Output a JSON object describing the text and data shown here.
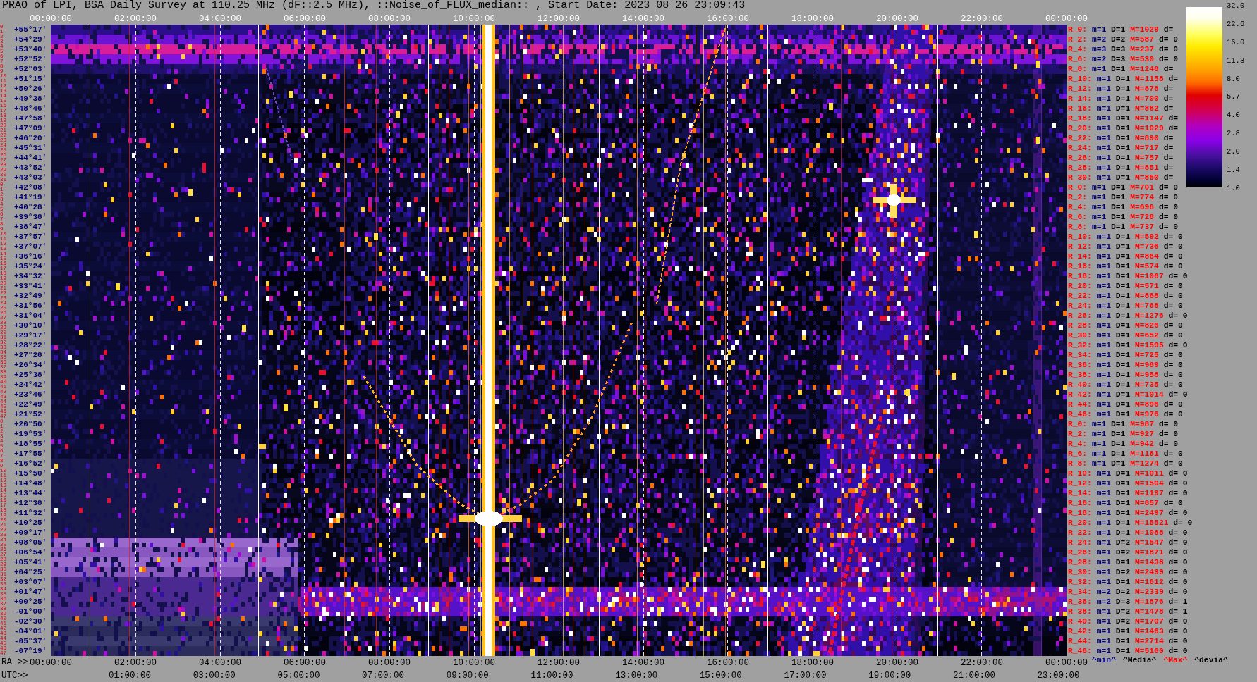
{
  "title": "PRAO of LPI, BSA Daily Survey at 110.25 MHz (dF::2.5 MHz), ::Noise_of_FLUX_median:: , Start Date: 2023 08 26 23:09:43",
  "top_axis": {
    "ticks": [
      "00:00:00",
      "02:00:00",
      "04:00:00",
      "06:00:00",
      "08:00:00",
      "10:00:00",
      "12:00:00",
      "14:00:00",
      "16:00:00",
      "18:00:00",
      "20:00:00",
      "22:00:00",
      "00:00:00"
    ]
  },
  "declination_axis": {
    "labels": [
      {
        "indices": [
          "0",
          "1"
        ],
        "declination": "+55°17′"
      },
      {
        "indices": [
          "2",
          "3"
        ],
        "declination": "+54°29′"
      },
      {
        "indices": [
          "4",
          "5"
        ],
        "declination": "+53°40′"
      },
      {
        "indices": [
          "6",
          "7"
        ],
        "declination": "+52°52′"
      },
      {
        "indices": [
          "8",
          "9"
        ],
        "declination": "+52°03′"
      },
      {
        "indices": [
          "10",
          "11"
        ],
        "declination": "+51°15′"
      },
      {
        "indices": [
          "12",
          "13"
        ],
        "declination": "+50°26′"
      },
      {
        "indices": [
          "14",
          "15"
        ],
        "declination": "+49°38′"
      },
      {
        "indices": [
          "16",
          "17"
        ],
        "declination": "+48°46′"
      },
      {
        "indices": [
          "18",
          "19"
        ],
        "declination": "+47°58′"
      },
      {
        "indices": [
          "20",
          "21"
        ],
        "declination": "+47°09′"
      },
      {
        "indices": [
          "22",
          "23"
        ],
        "declination": "+46°20′"
      },
      {
        "indices": [
          "24",
          "25"
        ],
        "declination": "+45°31′"
      },
      {
        "indices": [
          "26",
          "27"
        ],
        "declination": "+44°41′"
      },
      {
        "indices": [
          "28",
          "29"
        ],
        "declination": "+43°52′"
      },
      {
        "indices": [
          "30",
          "31"
        ],
        "declination": "+43°03′"
      },
      {
        "indices": [
          "0",
          "1"
        ],
        "declination": "+42°08′"
      },
      {
        "indices": [
          "2",
          "3"
        ],
        "declination": "+41°19′"
      },
      {
        "indices": [
          "4",
          "5"
        ],
        "declination": "+40°28′"
      },
      {
        "indices": [
          "6",
          "7"
        ],
        "declination": "+39°38′"
      },
      {
        "indices": [
          "8",
          "9"
        ],
        "declination": "+38°47′"
      },
      {
        "indices": [
          "10",
          "11"
        ],
        "declination": "+37°57′"
      },
      {
        "indices": [
          "12",
          "13"
        ],
        "declination": "+37°07′"
      },
      {
        "indices": [
          "14",
          "15"
        ],
        "declination": "+36°16′"
      },
      {
        "indices": [
          "16",
          "17"
        ],
        "declination": "+35°24′"
      },
      {
        "indices": [
          "18",
          "19"
        ],
        "declination": "+34°32′"
      },
      {
        "indices": [
          "20",
          "21"
        ],
        "declination": "+33°41′"
      },
      {
        "indices": [
          "22",
          "23"
        ],
        "declination": "+32°49′"
      },
      {
        "indices": [
          "24",
          "25"
        ],
        "declination": "+31°56′"
      },
      {
        "indices": [
          "26",
          "27"
        ],
        "declination": "+31°04′"
      },
      {
        "indices": [
          "28",
          "29"
        ],
        "declination": "+30°10′"
      },
      {
        "indices": [
          "30",
          "31"
        ],
        "declination": "+29°17′"
      },
      {
        "indices": [
          "32",
          "33"
        ],
        "declination": "+28°22′"
      },
      {
        "indices": [
          "34",
          "35"
        ],
        "declination": "+27°28′"
      },
      {
        "indices": [
          "36",
          "37"
        ],
        "declination": "+26°34′"
      },
      {
        "indices": [
          "38",
          "39"
        ],
        "declination": "+25°38′"
      },
      {
        "indices": [
          "40",
          "41"
        ],
        "declination": "+24°42′"
      },
      {
        "indices": [
          "42",
          "43"
        ],
        "declination": "+23°46′"
      },
      {
        "indices": [
          "44",
          "45"
        ],
        "declination": "+22°49′"
      },
      {
        "indices": [
          "46",
          "47"
        ],
        "declination": "+21°52′"
      },
      {
        "indices": [
          "0",
          "1"
        ],
        "declination": "+20°50′"
      },
      {
        "indices": [
          "2",
          "3"
        ],
        "declination": "+19°53′"
      },
      {
        "indices": [
          "4",
          "5"
        ],
        "declination": "+18°55′"
      },
      {
        "indices": [
          "6",
          "7"
        ],
        "declination": "+17°55′"
      },
      {
        "indices": [
          "8",
          "9"
        ],
        "declination": "+16°52′"
      },
      {
        "indices": [
          "10",
          "11"
        ],
        "declination": "+15°50′"
      },
      {
        "indices": [
          "12",
          "13"
        ],
        "declination": "+14°48′"
      },
      {
        "indices": [
          "14",
          "15"
        ],
        "declination": "+13°44′"
      },
      {
        "indices": [
          "16",
          "17"
        ],
        "declination": "+12°38′"
      },
      {
        "indices": [
          "18",
          "19"
        ],
        "declination": "+11°32′"
      },
      {
        "indices": [
          "20",
          "21"
        ],
        "declination": "+10°25′"
      },
      {
        "indices": [
          "22",
          "23"
        ],
        "declination": "+09°17′"
      },
      {
        "indices": [
          "24",
          "25"
        ],
        "declination": "+08°05′"
      },
      {
        "indices": [
          "26",
          "27"
        ],
        "declination": "+06°54′"
      },
      {
        "indices": [
          "28",
          "29"
        ],
        "declination": "+05°41′"
      },
      {
        "indices": [
          "30",
          "31"
        ],
        "declination": "+04°25′"
      },
      {
        "indices": [
          "32",
          "33"
        ],
        "declination": "+03°07′"
      },
      {
        "indices": [
          "34",
          "35"
        ],
        "declination": "+01°47′"
      },
      {
        "indices": [
          "36",
          "37"
        ],
        "declination": "+00°25′"
      },
      {
        "indices": [
          "38",
          "39"
        ],
        "declination": "-01°00′"
      },
      {
        "indices": [
          "40",
          "41"
        ],
        "declination": "-02°30′"
      },
      {
        "indices": [
          "42",
          "43"
        ],
        "declination": "-04°01′"
      },
      {
        "indices": [
          "44",
          "45"
        ],
        "declination": "-05°37′"
      },
      {
        "indices": [
          "46",
          "47"
        ],
        "declination": "-07°19′"
      }
    ]
  },
  "statistics": {
    "rows": [
      {
        "receiver": "R_0:",
        "min": "m=1",
        "median": "D=1",
        "max": "M=1029",
        "deviation": "d="
      },
      {
        "receiver": "R_2:",
        "min": "m=2",
        "median": "D=2",
        "max": "M=587",
        "deviation": "d= 0"
      },
      {
        "receiver": "R_4:",
        "min": "m=3",
        "median": "D=3",
        "max": "M=237",
        "deviation": "d= 0"
      },
      {
        "receiver": "R_6:",
        "min": "m=2",
        "median": "D=3",
        "max": "M=530",
        "deviation": "d= 0"
      },
      {
        "receiver": "R_8:",
        "min": "m=1",
        "median": "D=1",
        "max": "M=1248",
        "deviation": "d="
      },
      {
        "receiver": "R_10:",
        "min": "m=1",
        "median": "D=1",
        "max": "M=1158",
        "deviation": "d="
      },
      {
        "receiver": "R_12:",
        "min": "m=1",
        "median": "D=1",
        "max": "M=878",
        "deviation": "d="
      },
      {
        "receiver": "R_14:",
        "min": "m=1",
        "median": "D=1",
        "max": "M=700",
        "deviation": "d="
      },
      {
        "receiver": "R_16:",
        "min": "m=1",
        "median": "D=1",
        "max": "M=882",
        "deviation": "d="
      },
      {
        "receiver": "R_18:",
        "min": "m=1",
        "median": "D=1",
        "max": "M=1147",
        "deviation": "d="
      },
      {
        "receiver": "R_20:",
        "min": "m=1",
        "median": "D=1",
        "max": "M=1029",
        "deviation": "d="
      },
      {
        "receiver": "R_22:",
        "min": "m=1",
        "median": "D=1",
        "max": "M=890",
        "deviation": "d="
      },
      {
        "receiver": "R_24:",
        "min": "m=1",
        "median": "D=1",
        "max": "M=717",
        "deviation": "d="
      },
      {
        "receiver": "R_26:",
        "min": "m=1",
        "median": "D=1",
        "max": "M=757",
        "deviation": "d="
      },
      {
        "receiver": "R_28:",
        "min": "m=1",
        "median": "D=1",
        "max": "M=851",
        "deviation": "d="
      },
      {
        "receiver": "R_30:",
        "min": "m=1",
        "median": "D=1",
        "max": "M=850",
        "deviation": "d="
      },
      {
        "receiver": "R_0:",
        "min": "m=1",
        "median": "D=1",
        "max": "M=701",
        "deviation": "d= 0"
      },
      {
        "receiver": "R_2:",
        "min": "m=1",
        "median": "D=1",
        "max": "M=774",
        "deviation": "d= 0"
      },
      {
        "receiver": "R_4:",
        "min": "m=1",
        "median": "D=1",
        "max": "M=696",
        "deviation": "d= 0"
      },
      {
        "receiver": "R_6:",
        "min": "m=1",
        "median": "D=1",
        "max": "M=728",
        "deviation": "d= 0"
      },
      {
        "receiver": "R_8:",
        "min": "m=1",
        "median": "D=1",
        "max": "M=737",
        "deviation": "d= 0"
      },
      {
        "receiver": "R_10:",
        "min": "m=1",
        "median": "D=1",
        "max": "M=592",
        "deviation": "d= 0"
      },
      {
        "receiver": "R_12:",
        "min": "m=1",
        "median": "D=1",
        "max": "M=736",
        "deviation": "d= 0"
      },
      {
        "receiver": "R_14:",
        "min": "m=1",
        "median": "D=1",
        "max": "M=864",
        "deviation": "d= 0"
      },
      {
        "receiver": "R_16:",
        "min": "m=1",
        "median": "D=1",
        "max": "M=574",
        "deviation": "d= 0"
      },
      {
        "receiver": "R_18:",
        "min": "m=1",
        "median": "D=1",
        "max": "M=1067",
        "deviation": "d= 0"
      },
      {
        "receiver": "R_20:",
        "min": "m=1",
        "median": "D=1",
        "max": "M=571",
        "deviation": "d= 0"
      },
      {
        "receiver": "R_22:",
        "min": "m=1",
        "median": "D=1",
        "max": "M=868",
        "deviation": "d= 0"
      },
      {
        "receiver": "R_24:",
        "min": "m=1",
        "median": "D=1",
        "max": "M=768",
        "deviation": "d= 0"
      },
      {
        "receiver": "R_26:",
        "min": "m=1",
        "median": "D=1",
        "max": "M=1276",
        "deviation": "d= 0"
      },
      {
        "receiver": "R_28:",
        "min": "m=1",
        "median": "D=1",
        "max": "M=826",
        "deviation": "d= 0"
      },
      {
        "receiver": "R_30:",
        "min": "m=1",
        "median": "D=1",
        "max": "M=652",
        "deviation": "d= 0"
      },
      {
        "receiver": "R_32:",
        "min": "m=1",
        "median": "D=1",
        "max": "M=1595",
        "deviation": "d= 0"
      },
      {
        "receiver": "R_34:",
        "min": "m=1",
        "median": "D=1",
        "max": "M=725",
        "deviation": "d= 0"
      },
      {
        "receiver": "R_36:",
        "min": "m=1",
        "median": "D=1",
        "max": "M=989",
        "deviation": "d= 0"
      },
      {
        "receiver": "R_38:",
        "min": "m=1",
        "median": "D=1",
        "max": "M=958",
        "deviation": "d= 0"
      },
      {
        "receiver": "R_40:",
        "min": "m=1",
        "median": "D=1",
        "max": "M=735",
        "deviation": "d= 0"
      },
      {
        "receiver": "R_42:",
        "min": "m=1",
        "median": "D=1",
        "max": "M=1014",
        "deviation": "d= 0"
      },
      {
        "receiver": "R_44:",
        "min": "m=1",
        "median": "D=1",
        "max": "M=896",
        "deviation": "d= 0"
      },
      {
        "receiver": "R_46:",
        "min": "m=1",
        "median": "D=1",
        "max": "M=976",
        "deviation": "d= 0"
      },
      {
        "receiver": "R_0:",
        "min": "m=1",
        "median": "D=1",
        "max": "M=987",
        "deviation": "d= 0"
      },
      {
        "receiver": "R_2:",
        "min": "m=1",
        "median": "D=1",
        "max": "M=927",
        "deviation": "d= 0"
      },
      {
        "receiver": "R_4:",
        "min": "m=1",
        "median": "D=1",
        "max": "M=942",
        "deviation": "d= 0"
      },
      {
        "receiver": "R_6:",
        "min": "m=1",
        "median": "D=1",
        "max": "M=1181",
        "deviation": "d= 0"
      },
      {
        "receiver": "R_8:",
        "min": "m=1",
        "median": "D=1",
        "max": "M=1274",
        "deviation": "d= 0"
      },
      {
        "receiver": "R_10:",
        "min": "m=1",
        "median": "D=1",
        "max": "M=1011",
        "deviation": "d= 0"
      },
      {
        "receiver": "R_12:",
        "min": "m=1",
        "median": "D=1",
        "max": "M=1504",
        "deviation": "d= 0"
      },
      {
        "receiver": "R_14:",
        "min": "m=1",
        "median": "D=1",
        "max": "M=1197",
        "deviation": "d= 0"
      },
      {
        "receiver": "R_16:",
        "min": "m=1",
        "median": "D=1",
        "max": "M=857",
        "deviation": "d= 0"
      },
      {
        "receiver": "R_18:",
        "min": "m=1",
        "median": "D=1",
        "max": "M=2497",
        "deviation": "d= 0"
      },
      {
        "receiver": "R_20:",
        "min": "m=1",
        "median": "D=1",
        "max": "M=15521",
        "deviation": "d= 0"
      },
      {
        "receiver": "R_22:",
        "min": "m=1",
        "median": "D=1",
        "max": "M=1088",
        "deviation": "d= 0"
      },
      {
        "receiver": "R_24:",
        "min": "m=1",
        "median": "D=2",
        "max": "M=1547",
        "deviation": "d= 0"
      },
      {
        "receiver": "R_26:",
        "min": "m=1",
        "median": "D=2",
        "max": "M=1871",
        "deviation": "d= 0"
      },
      {
        "receiver": "R_28:",
        "min": "m=1",
        "median": "D=1",
        "max": "M=1438",
        "deviation": "d= 0"
      },
      {
        "receiver": "R_30:",
        "min": "m=1",
        "median": "D=2",
        "max": "M=2499",
        "deviation": "d= 0"
      },
      {
        "receiver": "R_32:",
        "min": "m=1",
        "median": "D=1",
        "max": "M=1612",
        "deviation": "d= 0"
      },
      {
        "receiver": "R_34:",
        "min": "m=2",
        "median": "D=2",
        "max": "M=2339",
        "deviation": "d= 0"
      },
      {
        "receiver": "R_36:",
        "min": "m=2",
        "median": "D=3",
        "max": "M=1876",
        "deviation": "d= 1"
      },
      {
        "receiver": "R_38:",
        "min": "m=1",
        "median": "D=2",
        "max": "M=1478",
        "deviation": "d= 1"
      },
      {
        "receiver": "R_40:",
        "min": "m=1",
        "median": "D=2",
        "max": "M=1707",
        "deviation": "d= 0"
      },
      {
        "receiver": "R_42:",
        "min": "m=1",
        "median": "D=1",
        "max": "M=1463",
        "deviation": "d= 0"
      },
      {
        "receiver": "R_44:",
        "min": "m=1",
        "median": "D=1",
        "max": "M=2714",
        "deviation": "d= 0"
      },
      {
        "receiver": "R_46:",
        "min": "m=1",
        "median": "D=1",
        "max": "M=5160",
        "deviation": "d= 0"
      }
    ]
  },
  "colorbar": {
    "ticks": [
      "32.0",
      "22.6",
      "16.0",
      "11.3",
      "8.0",
      "5.7",
      "4.0",
      "2.8",
      "2.0",
      "1.4",
      "1.0"
    ]
  },
  "bottom_axes": {
    "ra": {
      "title": "RA >>",
      "ticks": [
        "00:00:00",
        "02:00:00",
        "04:00:00",
        "06:00:00",
        "08:00:00",
        "10:00:00",
        "12:00:00",
        "14:00:00",
        "16:00:00",
        "18:00:00",
        "20:00:00",
        "22:00:00",
        "00:00:00"
      ]
    },
    "utc": {
      "title": "UTC>>",
      "ticks": [
        "01:00:00",
        "03:00:00",
        "05:00:00",
        "07:00:00",
        "09:00:00",
        "11:00:00",
        "13:00:00",
        "15:00:00",
        "17:00:00",
        "19:00:00",
        "21:00:00",
        "23:00:00"
      ]
    }
  },
  "legend": [
    {
      "text": "^min^",
      "color": "#000080"
    },
    {
      "text": "^Media^",
      "color": "#000000"
    },
    {
      "text": "^Max^",
      "color": "#ff0000"
    },
    {
      "text": "^devia^",
      "color": "#000000"
    }
  ]
}
